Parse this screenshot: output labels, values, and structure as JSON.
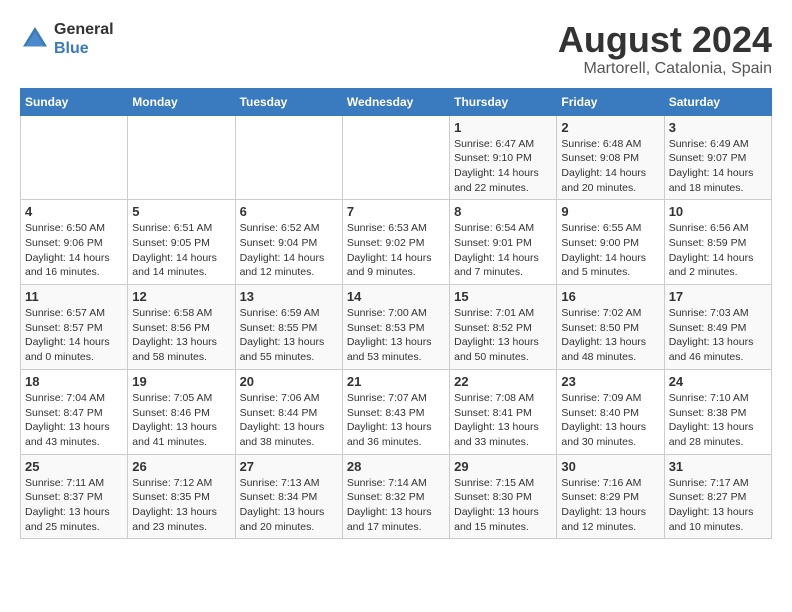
{
  "header": {
    "logo_line1": "General",
    "logo_line2": "Blue",
    "month": "August 2024",
    "location": "Martorell, Catalonia, Spain"
  },
  "weekdays": [
    "Sunday",
    "Monday",
    "Tuesday",
    "Wednesday",
    "Thursday",
    "Friday",
    "Saturday"
  ],
  "weeks": [
    [
      {
        "day": "",
        "info": ""
      },
      {
        "day": "",
        "info": ""
      },
      {
        "day": "",
        "info": ""
      },
      {
        "day": "",
        "info": ""
      },
      {
        "day": "1",
        "info": "Sunrise: 6:47 AM\nSunset: 9:10 PM\nDaylight: 14 hours\nand 22 minutes."
      },
      {
        "day": "2",
        "info": "Sunrise: 6:48 AM\nSunset: 9:08 PM\nDaylight: 14 hours\nand 20 minutes."
      },
      {
        "day": "3",
        "info": "Sunrise: 6:49 AM\nSunset: 9:07 PM\nDaylight: 14 hours\nand 18 minutes."
      }
    ],
    [
      {
        "day": "4",
        "info": "Sunrise: 6:50 AM\nSunset: 9:06 PM\nDaylight: 14 hours\nand 16 minutes."
      },
      {
        "day": "5",
        "info": "Sunrise: 6:51 AM\nSunset: 9:05 PM\nDaylight: 14 hours\nand 14 minutes."
      },
      {
        "day": "6",
        "info": "Sunrise: 6:52 AM\nSunset: 9:04 PM\nDaylight: 14 hours\nand 12 minutes."
      },
      {
        "day": "7",
        "info": "Sunrise: 6:53 AM\nSunset: 9:02 PM\nDaylight: 14 hours\nand 9 minutes."
      },
      {
        "day": "8",
        "info": "Sunrise: 6:54 AM\nSunset: 9:01 PM\nDaylight: 14 hours\nand 7 minutes."
      },
      {
        "day": "9",
        "info": "Sunrise: 6:55 AM\nSunset: 9:00 PM\nDaylight: 14 hours\nand 5 minutes."
      },
      {
        "day": "10",
        "info": "Sunrise: 6:56 AM\nSunset: 8:59 PM\nDaylight: 14 hours\nand 2 minutes."
      }
    ],
    [
      {
        "day": "11",
        "info": "Sunrise: 6:57 AM\nSunset: 8:57 PM\nDaylight: 14 hours\nand 0 minutes."
      },
      {
        "day": "12",
        "info": "Sunrise: 6:58 AM\nSunset: 8:56 PM\nDaylight: 13 hours\nand 58 minutes."
      },
      {
        "day": "13",
        "info": "Sunrise: 6:59 AM\nSunset: 8:55 PM\nDaylight: 13 hours\nand 55 minutes."
      },
      {
        "day": "14",
        "info": "Sunrise: 7:00 AM\nSunset: 8:53 PM\nDaylight: 13 hours\nand 53 minutes."
      },
      {
        "day": "15",
        "info": "Sunrise: 7:01 AM\nSunset: 8:52 PM\nDaylight: 13 hours\nand 50 minutes."
      },
      {
        "day": "16",
        "info": "Sunrise: 7:02 AM\nSunset: 8:50 PM\nDaylight: 13 hours\nand 48 minutes."
      },
      {
        "day": "17",
        "info": "Sunrise: 7:03 AM\nSunset: 8:49 PM\nDaylight: 13 hours\nand 46 minutes."
      }
    ],
    [
      {
        "day": "18",
        "info": "Sunrise: 7:04 AM\nSunset: 8:47 PM\nDaylight: 13 hours\nand 43 minutes."
      },
      {
        "day": "19",
        "info": "Sunrise: 7:05 AM\nSunset: 8:46 PM\nDaylight: 13 hours\nand 41 minutes."
      },
      {
        "day": "20",
        "info": "Sunrise: 7:06 AM\nSunset: 8:44 PM\nDaylight: 13 hours\nand 38 minutes."
      },
      {
        "day": "21",
        "info": "Sunrise: 7:07 AM\nSunset: 8:43 PM\nDaylight: 13 hours\nand 36 minutes."
      },
      {
        "day": "22",
        "info": "Sunrise: 7:08 AM\nSunset: 8:41 PM\nDaylight: 13 hours\nand 33 minutes."
      },
      {
        "day": "23",
        "info": "Sunrise: 7:09 AM\nSunset: 8:40 PM\nDaylight: 13 hours\nand 30 minutes."
      },
      {
        "day": "24",
        "info": "Sunrise: 7:10 AM\nSunset: 8:38 PM\nDaylight: 13 hours\nand 28 minutes."
      }
    ],
    [
      {
        "day": "25",
        "info": "Sunrise: 7:11 AM\nSunset: 8:37 PM\nDaylight: 13 hours\nand 25 minutes."
      },
      {
        "day": "26",
        "info": "Sunrise: 7:12 AM\nSunset: 8:35 PM\nDaylight: 13 hours\nand 23 minutes."
      },
      {
        "day": "27",
        "info": "Sunrise: 7:13 AM\nSunset: 8:34 PM\nDaylight: 13 hours\nand 20 minutes."
      },
      {
        "day": "28",
        "info": "Sunrise: 7:14 AM\nSunset: 8:32 PM\nDaylight: 13 hours\nand 17 minutes."
      },
      {
        "day": "29",
        "info": "Sunrise: 7:15 AM\nSunset: 8:30 PM\nDaylight: 13 hours\nand 15 minutes."
      },
      {
        "day": "30",
        "info": "Sunrise: 7:16 AM\nSunset: 8:29 PM\nDaylight: 13 hours\nand 12 minutes."
      },
      {
        "day": "31",
        "info": "Sunrise: 7:17 AM\nSunset: 8:27 PM\nDaylight: 13 hours\nand 10 minutes."
      }
    ]
  ]
}
